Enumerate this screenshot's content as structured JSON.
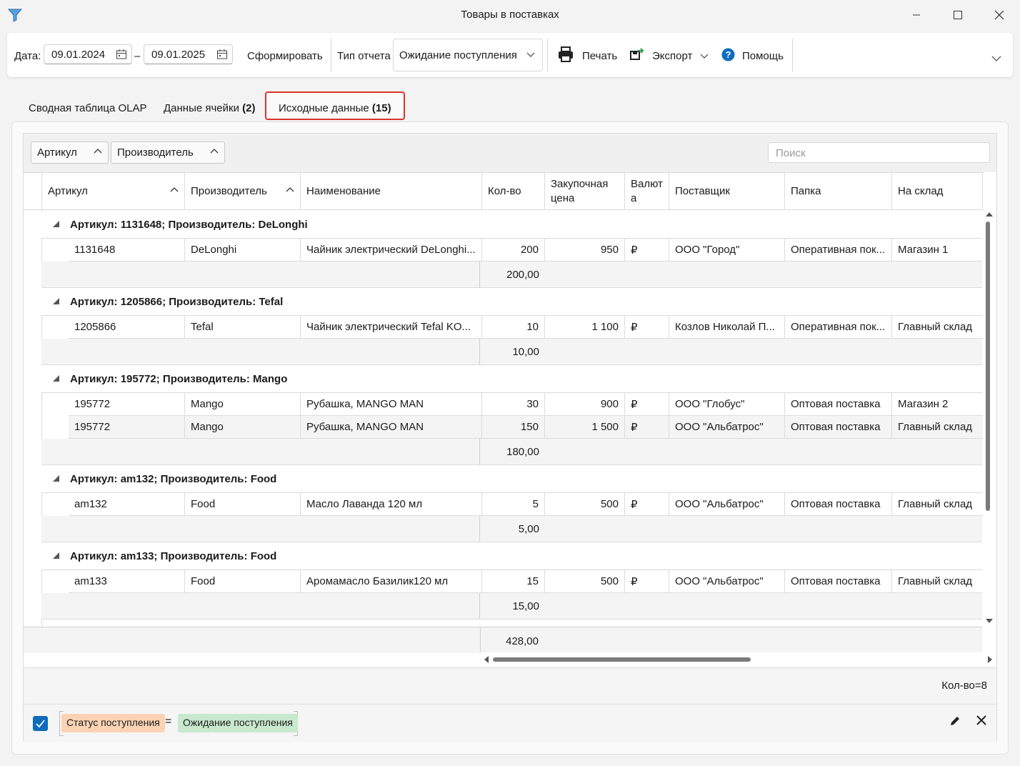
{
  "window": {
    "title": "Товары в поставках"
  },
  "toolbar": {
    "date_label": "Дата:",
    "date_from": "09.01.2024",
    "date_dash": "–",
    "date_to": "09.01.2025",
    "generate": "Сформировать",
    "report_type_label": "Тип отчета",
    "report_type_value": "Ожидание поступления",
    "print": "Печать",
    "export": "Экспорт",
    "help": "Помощь"
  },
  "tabs": [
    {
      "label": "Сводная таблица OLAP"
    },
    {
      "label": "Данные ячейки",
      "count": "(2)"
    },
    {
      "label": "Исходные данные",
      "count": "(15)"
    }
  ],
  "group_panel": {
    "chips": [
      "Артикул",
      "Производитель"
    ],
    "search_placeholder": "Поиск"
  },
  "columns": [
    "Артикул",
    "Производитель",
    "Наименование",
    "Кол-во",
    "Закупочная цена",
    "Валют а",
    "Поставщик",
    "Папка",
    "На склад"
  ],
  "groups": [
    {
      "title": "Артикул: 1131648; Производитель: DeLonghi",
      "rows": [
        [
          "1131648",
          "DeLonghi",
          "Чайник электрический DeLonghi...",
          "200",
          "950",
          "₽",
          "ООО \"Город\"",
          "Оперативная пок...",
          "Магазин 1"
        ]
      ],
      "sum": "200,00"
    },
    {
      "title": "Артикул: 1205866; Производитель: Tefal",
      "rows": [
        [
          "1205866",
          "Tefal",
          "Чайник электрический Tefal KO...",
          "10",
          "1 100",
          "₽",
          "Козлов Николай  П...",
          "Оперативная пок...",
          "Главный склад"
        ]
      ],
      "sum": "10,00"
    },
    {
      "title": "Артикул: 195772; Производитель: Mango",
      "rows": [
        [
          "195772",
          "Mango",
          "Рубашка, MANGO MAN",
          "30",
          "900",
          "₽",
          "ООО \"Глобус\"",
          "Оптовая поставка",
          "Магазин 2"
        ],
        [
          "195772",
          "Mango",
          "Рубашка, MANGO MAN",
          "150",
          "1 500",
          "₽",
          "ООО \"Альбатрос\"",
          "Оптовая поставка",
          "Главный склад"
        ]
      ],
      "sum": "180,00"
    },
    {
      "title": "Артикул: am132; Производитель: Food",
      "rows": [
        [
          "am132",
          "Food",
          "Масло Лаванда 120 мл",
          "5",
          "500",
          "₽",
          "ООО \"Альбатрос\"",
          "Оптовая поставка",
          "Главный склад"
        ]
      ],
      "sum": "5,00"
    },
    {
      "title": "Артикул: am133; Производитель: Food",
      "rows": [
        [
          "am133",
          "Food",
          "Аромамасло Базилик120 мл",
          "15",
          "500",
          "₽",
          "ООО \"Альбатрос\"",
          "Оптовая поставка",
          "Главный склад"
        ]
      ],
      "sum": "15,00"
    }
  ],
  "total": "428,00",
  "status": {
    "count": "Кол-во=8"
  },
  "filter": {
    "field": "Статус поступления",
    "op": "=",
    "value": "Ожидание поступления"
  },
  "colors": {
    "accent": "#0f6cbd",
    "tab_highlight": "#d9342b",
    "field_tag": "#fbd3b4",
    "value_tag": "#c9e9cf"
  }
}
